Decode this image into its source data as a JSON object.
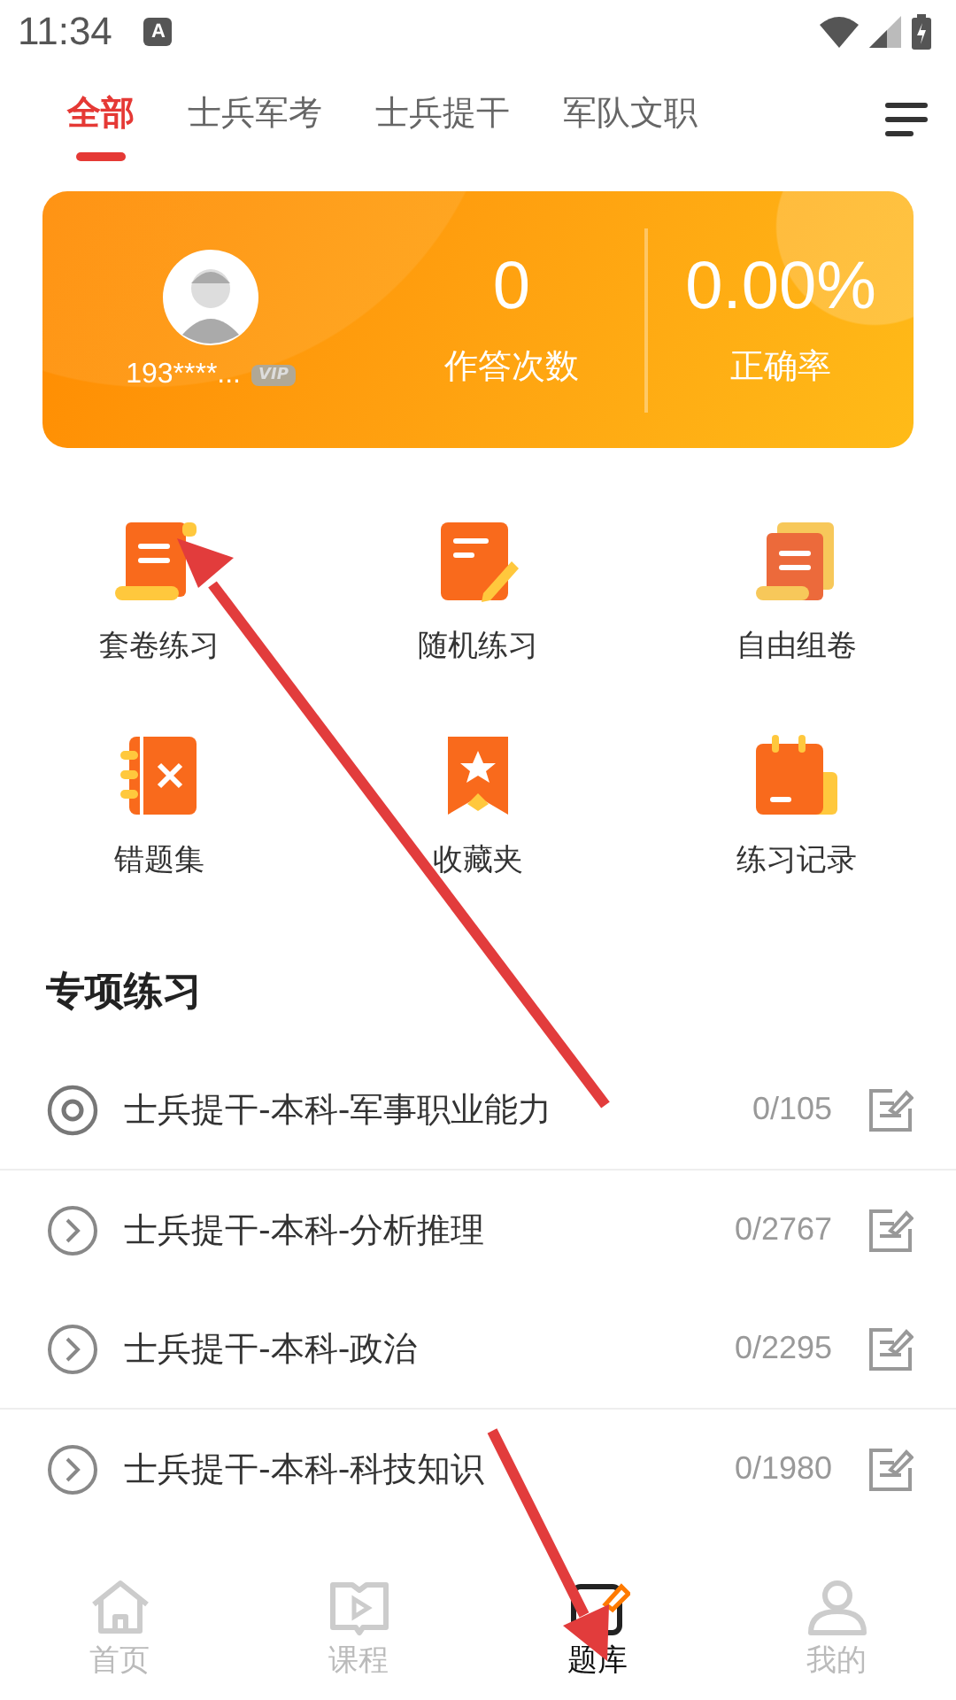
{
  "status_bar": {
    "time": "11:34",
    "notification": "A"
  },
  "tabs": [
    {
      "label": "全部",
      "selected": true
    },
    {
      "label": "士兵军考",
      "selected": false
    },
    {
      "label": "士兵提干",
      "selected": false
    },
    {
      "label": "军队文职",
      "selected": false
    }
  ],
  "profile_card": {
    "username": "193****...",
    "badge": "VIP",
    "stats": [
      {
        "value": "0",
        "label": "作答次数"
      },
      {
        "value": "0.00%",
        "label": "正确率"
      }
    ]
  },
  "features": [
    {
      "kind": "scroll",
      "label": "套卷练习"
    },
    {
      "kind": "pen",
      "label": "随机练习"
    },
    {
      "kind": "stack",
      "label": "自由组卷"
    },
    {
      "kind": "wrong",
      "label": "错题集"
    },
    {
      "kind": "star",
      "label": "收藏夹"
    },
    {
      "kind": "calendar",
      "label": "练习记录"
    }
  ],
  "section": {
    "title": "专项练习",
    "items": [
      {
        "title": "士兵提干-本科-军事职业能力",
        "count": "0/105",
        "selected": true
      },
      {
        "title": "士兵提干-本科-分析推理",
        "count": "0/2767",
        "selected": false
      },
      {
        "title": "士兵提干-本科-政治",
        "count": "0/2295",
        "selected": false
      },
      {
        "title": "士兵提干-本科-科技知识",
        "count": "0/1980",
        "selected": false
      }
    ]
  },
  "bottom_nav": [
    {
      "kind": "home",
      "label": "首页",
      "selected": false
    },
    {
      "kind": "course",
      "label": "课程",
      "selected": false
    },
    {
      "kind": "bank",
      "label": "题库",
      "selected": true
    },
    {
      "kind": "me",
      "label": "我的",
      "selected": false
    }
  ]
}
